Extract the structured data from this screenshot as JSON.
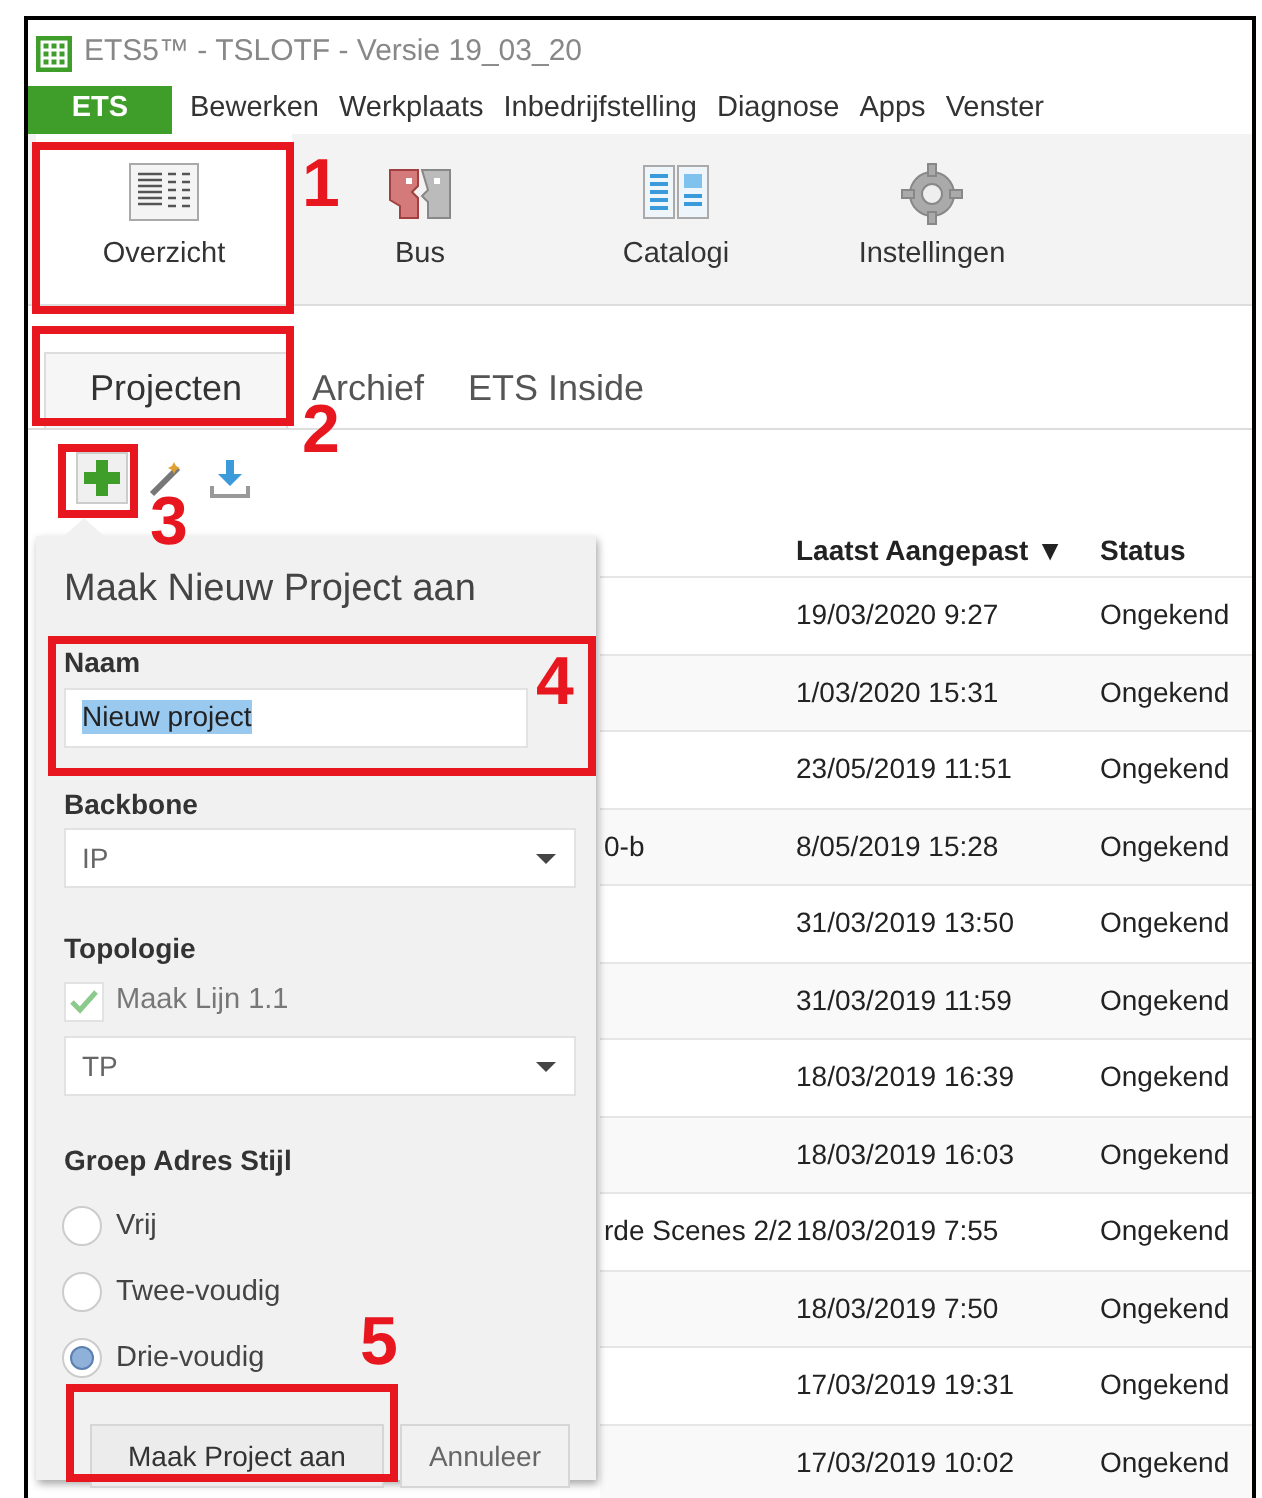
{
  "window": {
    "title": "ETS5™ - TSLOTF - Versie 19_03_20"
  },
  "menu": [
    {
      "label": "ETS",
      "selected": true
    },
    {
      "label": "Bewerken",
      "selected": false
    },
    {
      "label": "Werkplaats",
      "selected": false
    },
    {
      "label": "Inbedrijfstelling",
      "selected": false
    },
    {
      "label": "Diagnose",
      "selected": false
    },
    {
      "label": "Apps",
      "selected": false
    },
    {
      "label": "Venster",
      "selected": false
    }
  ],
  "ribbon": [
    {
      "label": "Overzicht",
      "kind": "overview",
      "selected": true
    },
    {
      "label": "Bus",
      "kind": "bus",
      "selected": false
    },
    {
      "label": "Catalogi",
      "kind": "catalog",
      "selected": false
    },
    {
      "label": "Instellingen",
      "kind": "settings",
      "selected": false
    }
  ],
  "tabs": [
    {
      "label": "Projecten",
      "selected": true
    },
    {
      "label": "Archief",
      "selected": false
    },
    {
      "label": "ETS Inside",
      "selected": false
    }
  ],
  "toolbar": [
    {
      "kind": "add"
    },
    {
      "kind": "wand"
    },
    {
      "kind": "import"
    }
  ],
  "table": {
    "columns": [
      "Laatst Aangepast ▼",
      "Status"
    ],
    "rows": [
      {
        "name": "",
        "modified": "19/03/2020 9:27",
        "status": "Ongekend"
      },
      {
        "name": "",
        "modified": "1/03/2020 15:31",
        "status": "Ongekend"
      },
      {
        "name": "",
        "modified": "23/05/2019 11:51",
        "status": "Ongekend"
      },
      {
        "name": "0-b",
        "modified": "8/05/2019 15:28",
        "status": "Ongekend"
      },
      {
        "name": "",
        "modified": "31/03/2019 13:50",
        "status": "Ongekend"
      },
      {
        "name": "",
        "modified": "31/03/2019 11:59",
        "status": "Ongekend"
      },
      {
        "name": "",
        "modified": "18/03/2019 16:39",
        "status": "Ongekend"
      },
      {
        "name": "",
        "modified": "18/03/2019 16:03",
        "status": "Ongekend"
      },
      {
        "name": "rde Scenes 2/2",
        "modified": "18/03/2019 7:55",
        "status": "Ongekend"
      },
      {
        "name": "",
        "modified": "18/03/2019 7:50",
        "status": "Ongekend"
      },
      {
        "name": "",
        "modified": "17/03/2019 19:31",
        "status": "Ongekend"
      },
      {
        "name": "",
        "modified": "17/03/2019 10:02",
        "status": "Ongekend"
      }
    ]
  },
  "popup": {
    "title": "Maak Nieuw Project aan",
    "name_label": "Naam",
    "name_value": "Nieuw project",
    "backbone_label": "Backbone",
    "backbone_value": "IP",
    "topology_label": "Topologie",
    "line_checkbox": {
      "label": "Maak Lijn 1.1",
      "checked": true,
      "disabled": true
    },
    "topology_value": "TP",
    "group_label": "Groep Adres Stijl",
    "radios": [
      {
        "label": "Vrij",
        "selected": false
      },
      {
        "label": "Twee-voudig",
        "selected": false
      },
      {
        "label": "Drie-voudig",
        "selected": true
      }
    ],
    "buttons": [
      "Maak Project aan",
      "Annuleer"
    ]
  },
  "annotations": [
    "1",
    "2",
    "3",
    "4",
    "5"
  ]
}
